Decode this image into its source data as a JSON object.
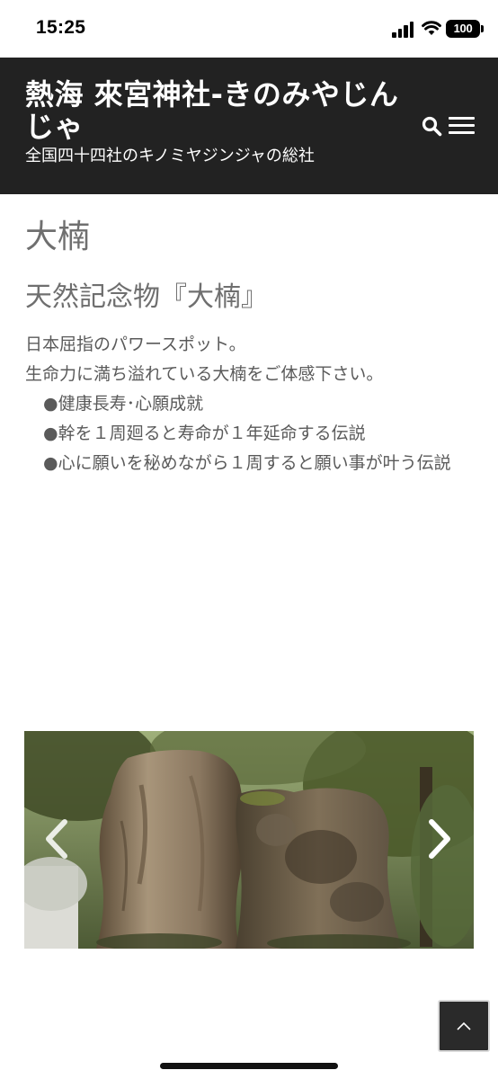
{
  "status_bar": {
    "time": "15:25",
    "battery": "100",
    "icons": [
      "cellular-signal-icon",
      "wifi-icon",
      "battery-icon"
    ]
  },
  "header": {
    "title": "熱海 來宮神社-きのみやじんじゃ",
    "tagline": "全国四十四社のキノミヤジンジャの総社",
    "background_color": "#222222",
    "icons": [
      "search-icon",
      "menu-icon"
    ]
  },
  "page": {
    "title": "大楠",
    "heading": "天然記念物『大楠』",
    "paragraphs": [
      "日本屈指のパワースポット。",
      "生命力に満ち溢れている大楠をご体感下さい。"
    ],
    "bullets": [
      "●健康長寿･心願成就",
      "●幹を１周廻ると寿命が１年延命する伝説",
      "●心に願いを秘めながら１周すると願い事が叶う伝説"
    ],
    "text_color": "#5a5a5a"
  },
  "slider": {
    "image_subject": "photo-giant-camphor-tree",
    "icons": [
      "chevron-left-icon",
      "chevron-right-icon"
    ]
  },
  "back_to_top": {
    "icon": "chevron-up-icon"
  }
}
